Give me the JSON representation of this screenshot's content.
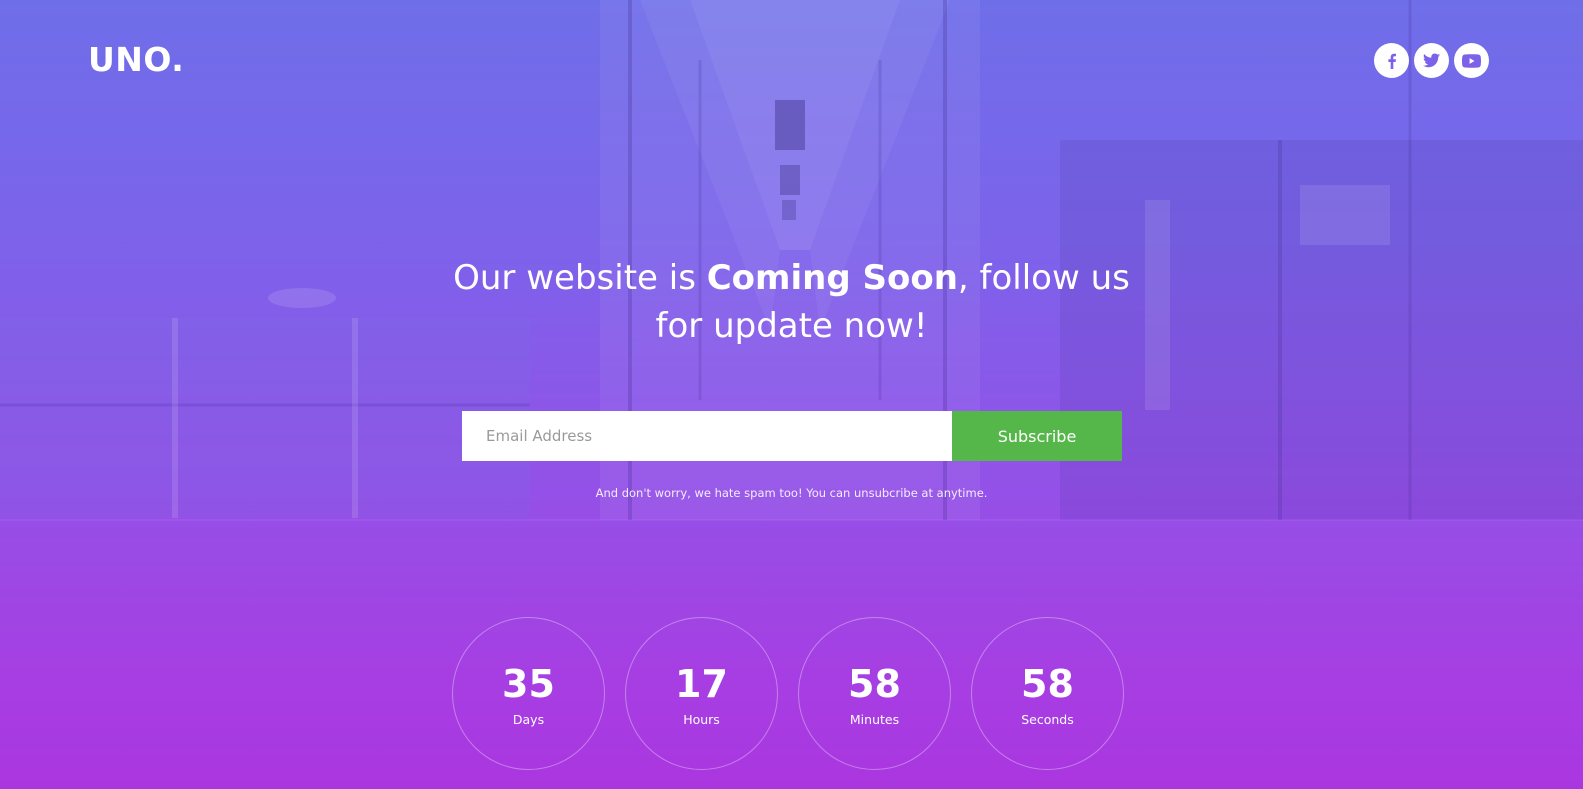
{
  "brand": {
    "logo_text": "UNO."
  },
  "social": [
    {
      "name": "facebook",
      "icon": "facebook-icon"
    },
    {
      "name": "twitter",
      "icon": "twitter-icon"
    },
    {
      "name": "youtube",
      "icon": "youtube-icon"
    }
  ],
  "hero": {
    "headline_pre": "Our website is ",
    "headline_strong": "Coming Soon",
    "headline_post": ", follow us",
    "headline_line2": "for update now!"
  },
  "subscribe": {
    "placeholder": "Email Address",
    "value": "",
    "button_label": "Subscribe",
    "note": "And don't worry, we hate spam too! You can unsubcribe at anytime."
  },
  "countdown": [
    {
      "value": "35",
      "label": "Days"
    },
    {
      "value": "17",
      "label": "Hours"
    },
    {
      "value": "58",
      "label": "Minutes"
    },
    {
      "value": "58",
      "label": "Seconds"
    }
  ],
  "colors": {
    "gradient_top": "#6f6ee9",
    "gradient_bottom": "#aa36e0",
    "subscribe_button": "#55b74a",
    "text": "#ffffff"
  }
}
